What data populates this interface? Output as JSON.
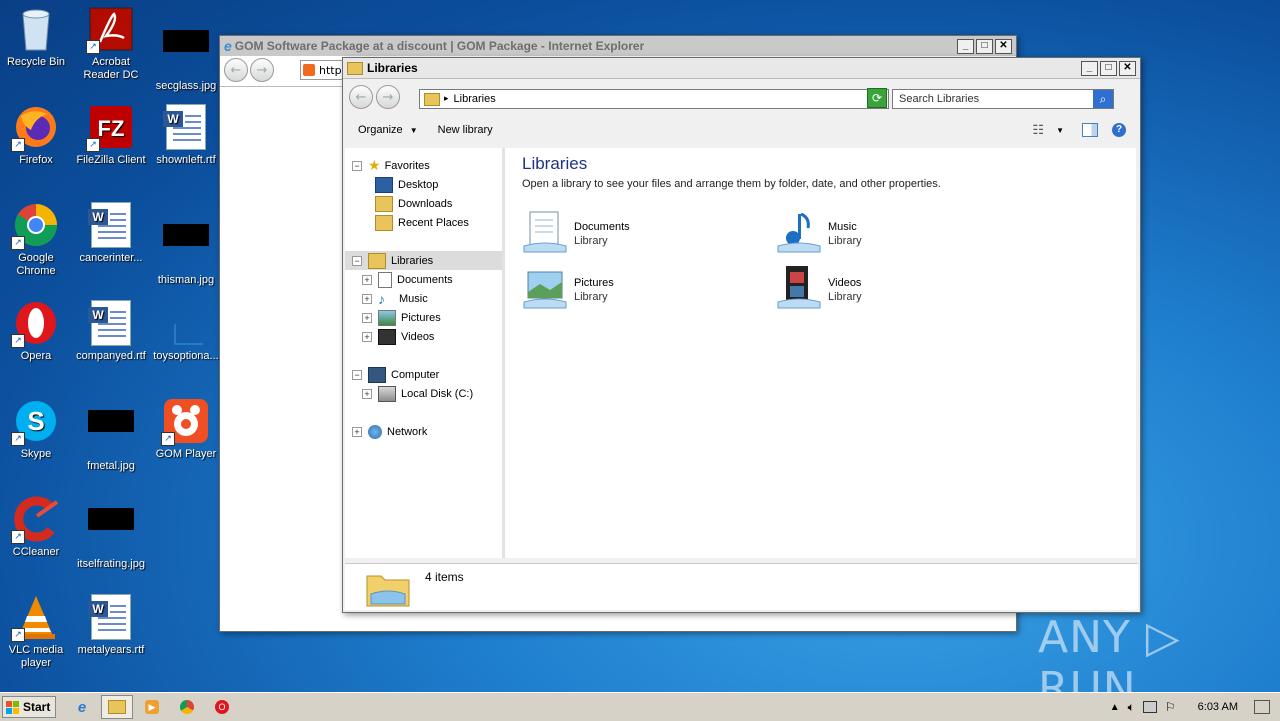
{
  "desktop": {
    "icons": [
      {
        "label": "Recycle Bin",
        "icon": "recycle-bin-icon"
      },
      {
        "label": "Acrobat Reader DC",
        "icon": "acrobat-icon"
      },
      {
        "label": "secglass.jpg",
        "icon": "image-file-icon"
      },
      {
        "label": "Firefox",
        "icon": "firefox-icon"
      },
      {
        "label": "FileZilla Client",
        "icon": "filezilla-icon"
      },
      {
        "label": "shownleft.rtf",
        "icon": "word-doc-icon"
      },
      {
        "label": "Google Chrome",
        "icon": "chrome-icon"
      },
      {
        "label": "cancerinter...",
        "icon": "word-doc-icon"
      },
      {
        "label": "thisman.jpg",
        "icon": "image-file-icon"
      },
      {
        "label": "Opera",
        "icon": "opera-icon"
      },
      {
        "label": "companyed.rtf",
        "icon": "word-doc-icon"
      },
      {
        "label": "toysoptiona...",
        "icon": "file-icon"
      },
      {
        "label": "Skype",
        "icon": "skype-icon"
      },
      {
        "label": "fmetal.jpg",
        "icon": "image-file-icon"
      },
      {
        "label": "GOM Player",
        "icon": "gom-player-icon"
      },
      {
        "label": "CCleaner",
        "icon": "ccleaner-icon"
      },
      {
        "label": "itselfrating.jpg",
        "icon": "image-file-icon"
      },
      {
        "label": "VLC media player",
        "icon": "vlc-icon"
      },
      {
        "label": "metalyears.rtf",
        "icon": "word-doc-icon"
      }
    ]
  },
  "ie_window": {
    "title": "GOM Software Package at a discount | GOM Package - Internet Explorer",
    "address_partial": "http"
  },
  "explorer": {
    "title": "Libraries",
    "address": "Libraries",
    "search_placeholder": "Search Libraries",
    "toolbar": {
      "organize": "Organize",
      "new_library": "New library"
    },
    "tree": {
      "favorites": "Favorites",
      "desktop": "Desktop",
      "downloads": "Downloads",
      "recent_places": "Recent Places",
      "libraries": "Libraries",
      "documents": "Documents",
      "music": "Music",
      "pictures": "Pictures",
      "videos": "Videos",
      "computer": "Computer",
      "local_disk": "Local Disk (C:)",
      "network": "Network"
    },
    "content": {
      "heading": "Libraries",
      "description": "Open a library to see your files and arrange them by folder, date, and other properties.",
      "items": [
        {
          "name": "Documents",
          "type": "Library"
        },
        {
          "name": "Music",
          "type": "Library"
        },
        {
          "name": "Pictures",
          "type": "Library"
        },
        {
          "name": "Videos",
          "type": "Library"
        }
      ]
    },
    "status": "4 items"
  },
  "taskbar": {
    "start": "Start",
    "clock": "6:03 AM"
  },
  "watermark": "ANY ▷ RUN"
}
